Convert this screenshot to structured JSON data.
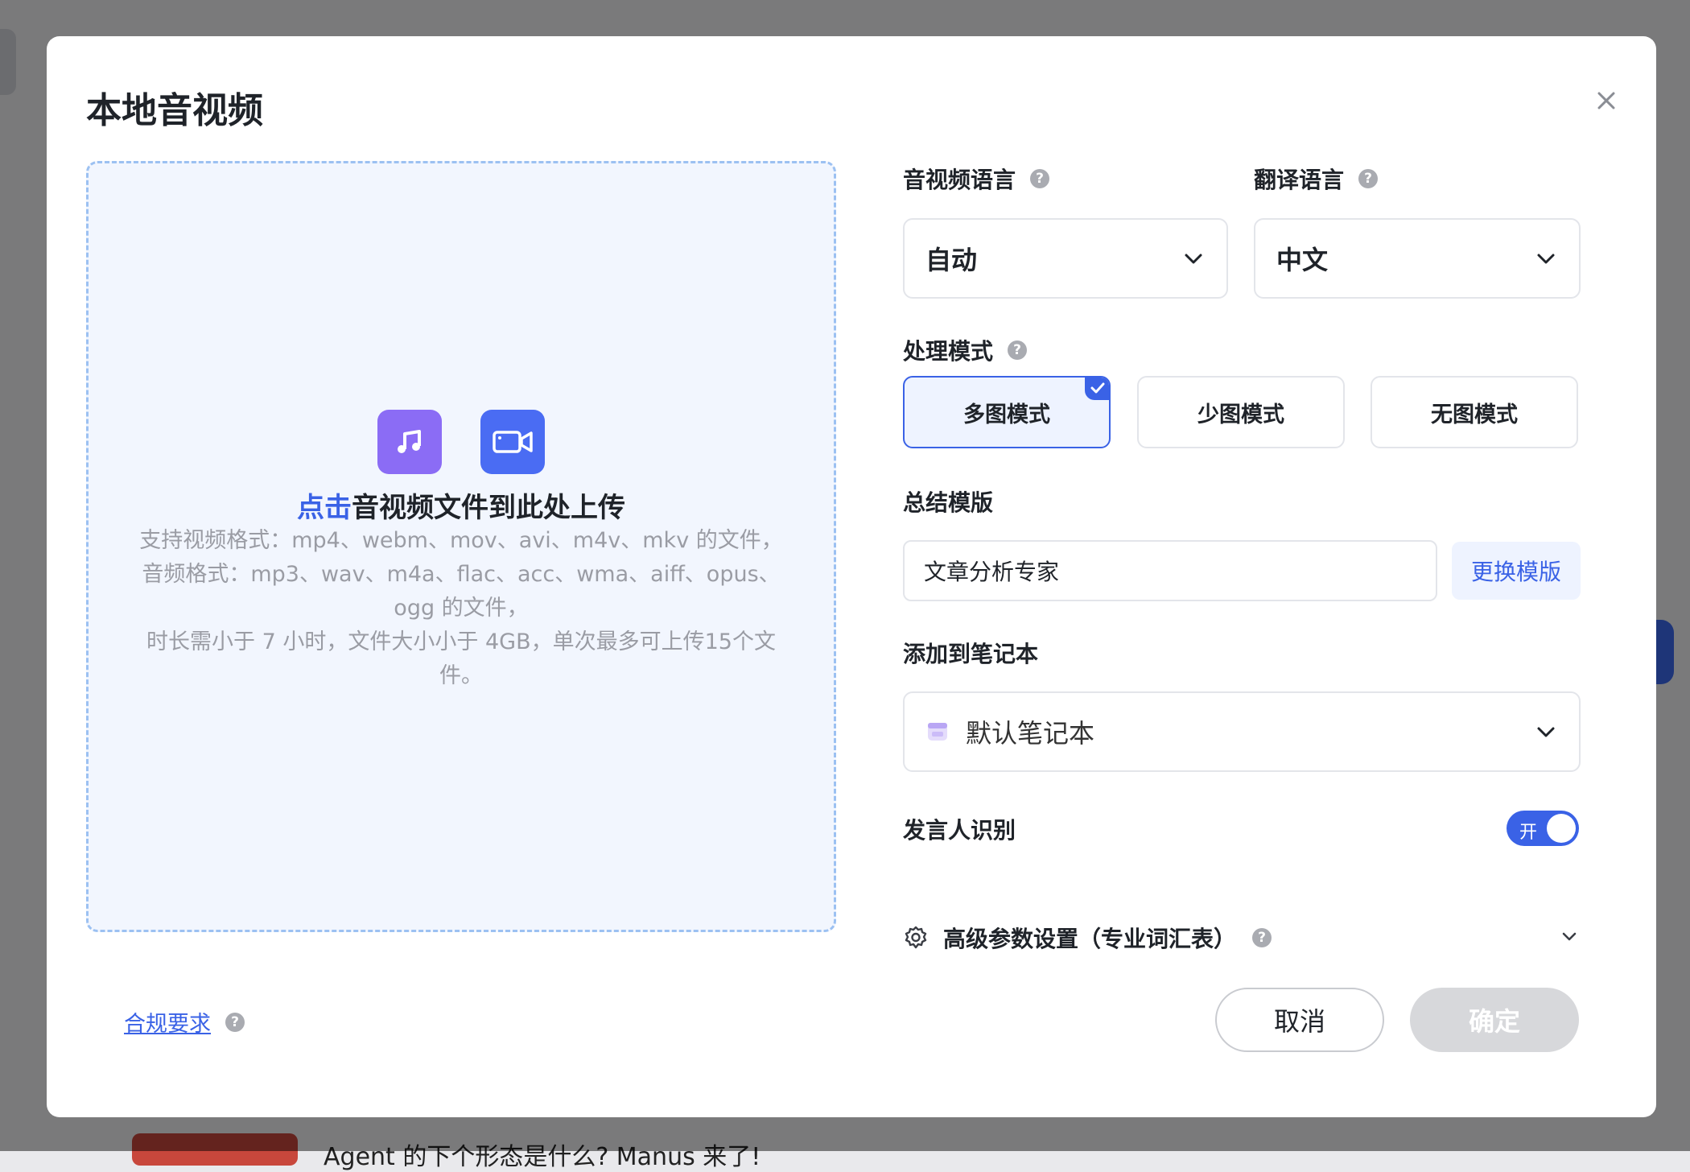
{
  "background": {
    "card_title": "Agent 的下个形态是什么? Manus 来了!"
  },
  "dialog": {
    "title": "本地音视频",
    "close_icon": "close-icon"
  },
  "upload": {
    "link_text": "点击",
    "title_rest": "音视频文件到此处上传",
    "desc_line1": "支持视频格式：mp4、webm、mov、avi、m4v、mkv 的文件，",
    "desc_line2": "音频格式：mp3、wav、m4a、flac、acc、wma、aiff、opus、",
    "desc_line3": "ogg 的文件，",
    "desc_line4": "时长需小于 7 小时，文件大小小于 4GB，单次最多可上传15个文",
    "desc_line5": "件。",
    "icons": [
      "music-icon",
      "video-camera-icon"
    ],
    "colors": {
      "audio": "#8b6cf5",
      "video": "#4a6cf3",
      "zone_bg": "#f2f6fe",
      "zone_border": "#9cc1f2"
    }
  },
  "settings": {
    "audio_language_label": "音视频语言",
    "audio_language_value": "自动",
    "translate_language_label": "翻译语言",
    "translate_language_value": "中文",
    "mode_label": "处理模式",
    "modes": [
      {
        "label": "多图模式",
        "selected": true
      },
      {
        "label": "少图模式",
        "selected": false
      },
      {
        "label": "无图模式",
        "selected": false
      }
    ],
    "template_label": "总结模版",
    "template_value": "文章分析专家",
    "change_template_label": "更换模版",
    "notebook_label": "添加到笔记本",
    "notebook_value": "默认笔记本",
    "speaker_label": "发言人识别",
    "speaker_toggle_text": "开",
    "speaker_enabled": true,
    "advanced_label": "高级参数设置（专业词汇表）"
  },
  "footer": {
    "compliance_label": "合规要求",
    "cancel_label": "取消",
    "confirm_label": "确定",
    "confirm_enabled": false
  },
  "colors": {
    "accent": "#3a62e6",
    "overlay": "rgba(0,0,0,0.5)",
    "confirm_disabled": "#d7d8db"
  },
  "help_glyph": "?"
}
